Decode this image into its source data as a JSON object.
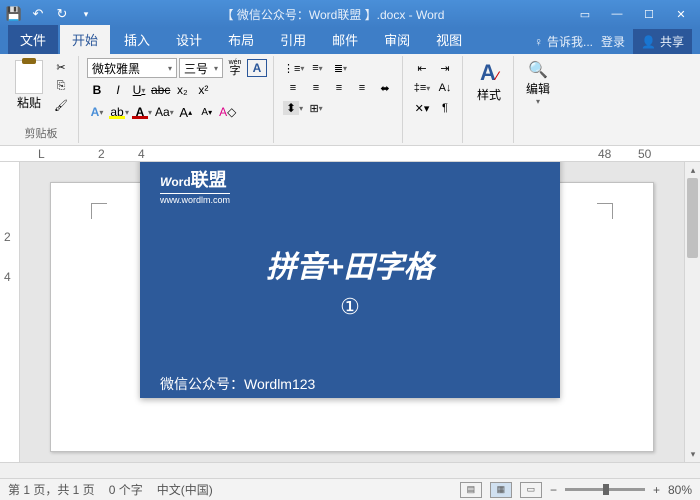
{
  "titlebar": {
    "title": "【 微信公众号：Word联盟 】.docx - Word"
  },
  "tabs": {
    "file": "文件",
    "home": "开始",
    "insert": "插入",
    "design": "设计",
    "layout": "布局",
    "ref": "引用",
    "mail": "邮件",
    "review": "审阅",
    "view": "视图",
    "tell": "告诉我...",
    "login": "登录",
    "share": "共享"
  },
  "ribbon": {
    "clipboard": {
      "paste": "粘贴",
      "label": "剪贴板"
    },
    "font": {
      "name": "微软雅黑",
      "size": "三号",
      "wen": "wén",
      "A": "A"
    },
    "styles": {
      "label": "样式"
    },
    "editing": {
      "label": "编辑"
    }
  },
  "ruler": {
    "n2": "2",
    "n4": "4",
    "n48": "48",
    "n50": "50"
  },
  "overlay": {
    "logo_main": "Word联盟",
    "logo_sub": "www.wordlm.com",
    "title": "拼音+田字格",
    "num": "①",
    "footer": "微信公众号：Wordlm123"
  },
  "status": {
    "page": "第 1 页，共 1 页",
    "words": "0 个字",
    "lang": "中文(中国)",
    "zoom_minus": "−",
    "zoom_plus": "+",
    "zoom": "80%"
  }
}
